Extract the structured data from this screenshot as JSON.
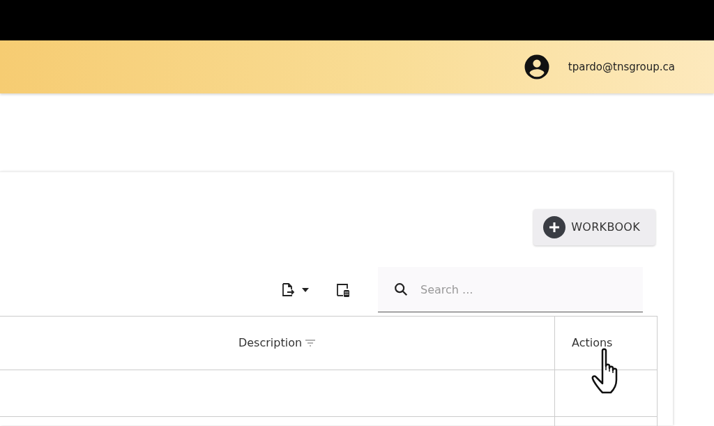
{
  "header": {
    "user_email": "tpardo@tnsgroup.ca"
  },
  "add_button": {
    "label": "WORKBOOK"
  },
  "search": {
    "placeholder": "Search ..."
  },
  "table": {
    "columns": [
      {
        "label": "Description",
        "kind": "filterable"
      },
      {
        "label": "Actions",
        "kind": "plain"
      }
    ],
    "rows": [
      {
        "cells": []
      },
      {
        "cells": []
      }
    ]
  }
}
